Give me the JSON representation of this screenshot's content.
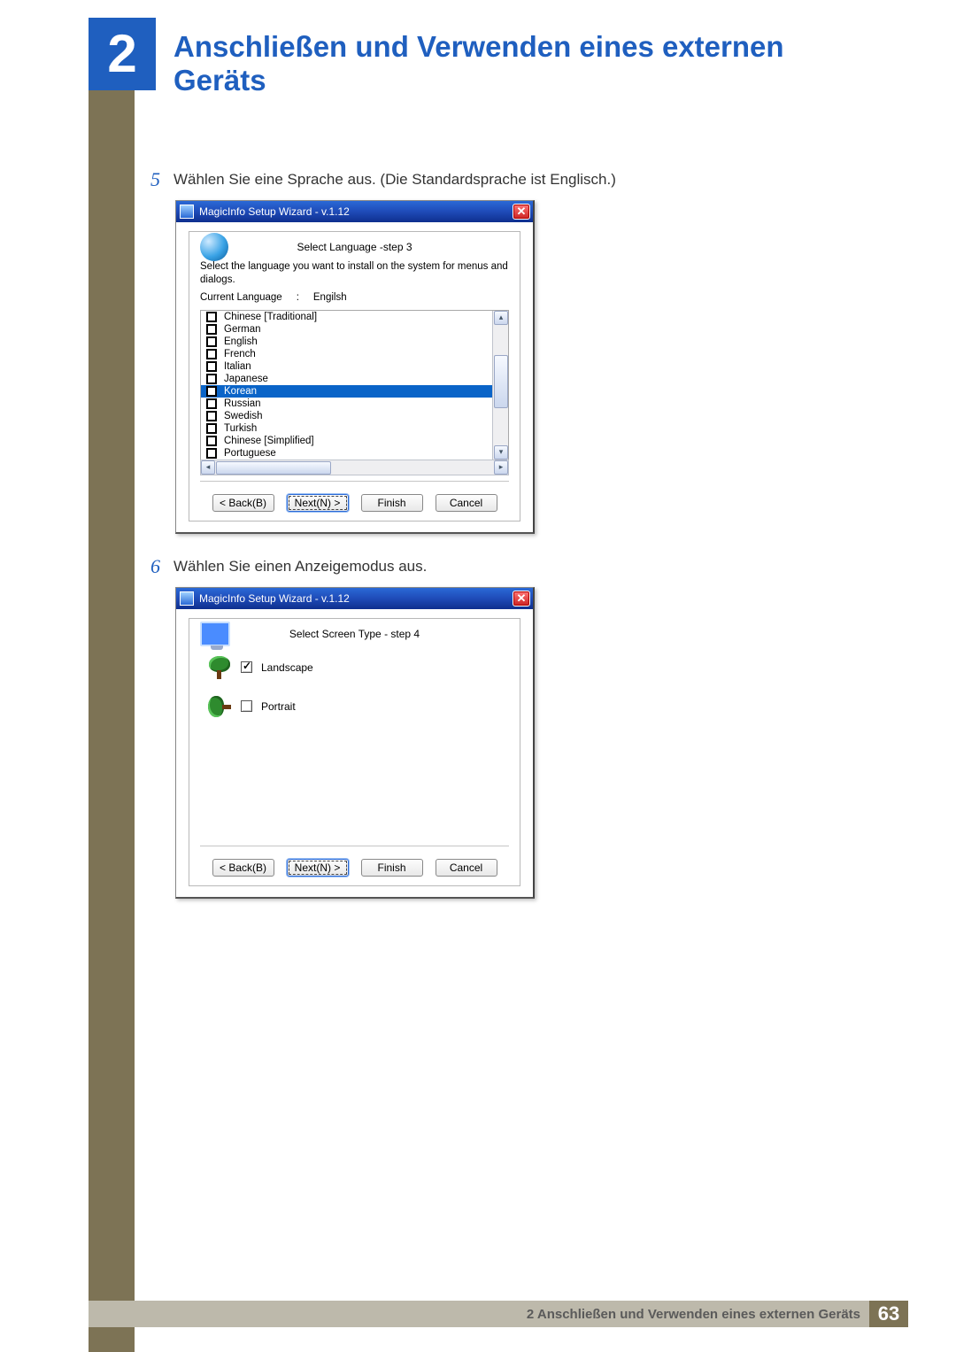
{
  "chapter": {
    "number": "2",
    "title": "Anschließen und Verwenden eines externen Geräts"
  },
  "steps": {
    "s5": {
      "num": "5",
      "text": "Wählen Sie eine Sprache aus. (Die Standardsprache ist Englisch.)"
    },
    "s6": {
      "num": "6",
      "text": "Wählen Sie einen Anzeigemodus aus."
    }
  },
  "wizard_common": {
    "title": "MagicInfo Setup Wizard - v.1.12",
    "close": "✕",
    "back": "< Back(B)",
    "next": "Next(N) >",
    "finish": "Finish",
    "cancel": "Cancel"
  },
  "wizard1": {
    "header": "Select Language -step 3",
    "desc": "Select the language you want to install on the system for menus and dialogs.",
    "current_label": "Current Language",
    "current_sep": ":",
    "current_value": "Engilsh",
    "languages": [
      "Chinese [Traditional]",
      "German",
      "English",
      "French",
      "Italian",
      "Japanese",
      "Korean",
      "Russian",
      "Swedish",
      "Turkish",
      "Chinese [Simplified]",
      "Portuguese"
    ],
    "selected_index": 6
  },
  "wizard2": {
    "header": "Select Screen Type - step 4",
    "landscape": "Landscape",
    "portrait": "Portrait"
  },
  "footer": {
    "text": "2 Anschließen und Verwenden eines externen Geräts",
    "page": "63"
  }
}
